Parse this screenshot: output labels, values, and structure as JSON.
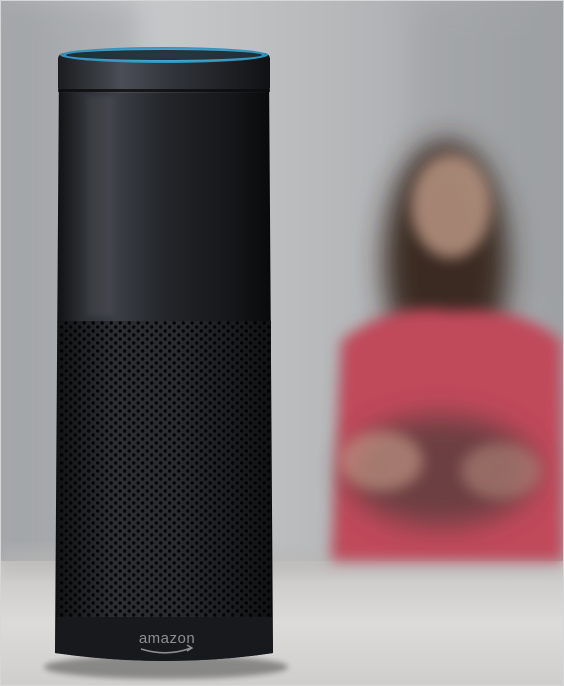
{
  "photo": {
    "device_logo_text": "amazon",
    "colors": {
      "light_ring": "#4fb8e0",
      "speaker_body": "#1c1e21",
      "background_wall": "#b9bbbd",
      "table_surface": "#d9d8d6",
      "person_shirt": "#c0485a",
      "person_hair": "#3a2a24"
    }
  }
}
